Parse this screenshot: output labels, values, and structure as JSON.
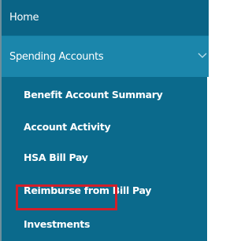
{
  "nav": {
    "home_label": "Home",
    "spending_label": "Spending Accounts",
    "sub_items": [
      {
        "label": "Benefit Account Summary"
      },
      {
        "label": "Account Activity"
      },
      {
        "label": "HSA Bill Pay"
      },
      {
        "label": "Reimburse from Bill Pay"
      },
      {
        "label": "Investments"
      }
    ],
    "highlighted_item": "Investments",
    "icons": {
      "expand": "chevron-down-icon"
    }
  },
  "colors": {
    "nav_background": "#0b6a8c",
    "active_section_background": "#1b86ab",
    "highlight_border": "#d11f2a",
    "text": "#ffffff"
  }
}
